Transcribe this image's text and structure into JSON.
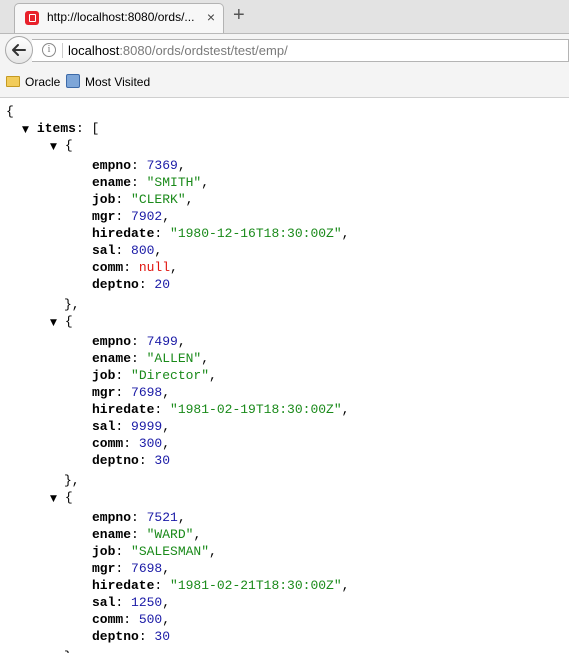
{
  "tab": {
    "title": "http://localhost:8080/ords/...",
    "close": "×",
    "new_tab": "+"
  },
  "address_bar": {
    "host": "localhost",
    "rest": ":8080/ords/ordstest/test/emp/",
    "info": "i"
  },
  "bookmarks": [
    {
      "label": "Oracle",
      "icon": "folder-icon"
    },
    {
      "label": "Most Visited",
      "icon": "most-visited-icon"
    }
  ],
  "json_view": {
    "open_brace": "{",
    "items_key": "items",
    "items_open": "[",
    "records": [
      {
        "fields": [
          {
            "key": "empno",
            "value": "7369",
            "type": "num"
          },
          {
            "key": "ename",
            "value": "\"SMITH\"",
            "type": "str"
          },
          {
            "key": "job",
            "value": "\"CLERK\"",
            "type": "str"
          },
          {
            "key": "mgr",
            "value": "7902",
            "type": "num"
          },
          {
            "key": "hiredate",
            "value": "\"1980-12-16T18:30:00Z\"",
            "type": "str"
          },
          {
            "key": "sal",
            "value": "800",
            "type": "num"
          },
          {
            "key": "comm",
            "value": "null",
            "type": "nul"
          },
          {
            "key": "deptno",
            "value": "20",
            "type": "num"
          }
        ]
      },
      {
        "fields": [
          {
            "key": "empno",
            "value": "7499",
            "type": "num"
          },
          {
            "key": "ename",
            "value": "\"ALLEN\"",
            "type": "str"
          },
          {
            "key": "job",
            "value": "\"Director\"",
            "type": "str"
          },
          {
            "key": "mgr",
            "value": "7698",
            "type": "num"
          },
          {
            "key": "hiredate",
            "value": "\"1981-02-19T18:30:00Z\"",
            "type": "str"
          },
          {
            "key": "sal",
            "value": "9999",
            "type": "num"
          },
          {
            "key": "comm",
            "value": "300",
            "type": "num"
          },
          {
            "key": "deptno",
            "value": "30",
            "type": "num"
          }
        ]
      },
      {
        "fields": [
          {
            "key": "empno",
            "value": "7521",
            "type": "num"
          },
          {
            "key": "ename",
            "value": "\"WARD\"",
            "type": "str"
          },
          {
            "key": "job",
            "value": "\"SALESMAN\"",
            "type": "str"
          },
          {
            "key": "mgr",
            "value": "7698",
            "type": "num"
          },
          {
            "key": "hiredate",
            "value": "\"1981-02-21T18:30:00Z\"",
            "type": "str"
          },
          {
            "key": "sal",
            "value": "1250",
            "type": "num"
          },
          {
            "key": "comm",
            "value": "500",
            "type": "num"
          },
          {
            "key": "deptno",
            "value": "30",
            "type": "num"
          }
        ]
      }
    ]
  },
  "colors": {
    "number": "#1a1aa6",
    "string": "#1a8a1a",
    "null": "#e0140e"
  }
}
